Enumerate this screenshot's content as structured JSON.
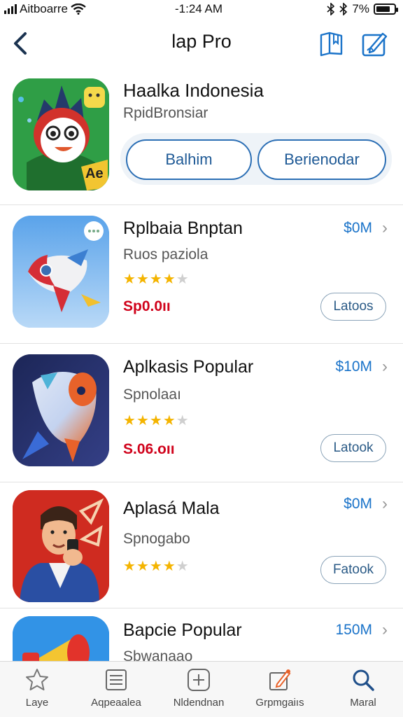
{
  "status_bar": {
    "carrier": "Aitboarre",
    "time": "-1:24 AM",
    "battery": "7%",
    "battery_level": 0.8
  },
  "header": {
    "title": "lap Pro",
    "back_icon": "chevron-left-icon",
    "actions": [
      "bookmark-book-icon",
      "edit-icon"
    ]
  },
  "featured": {
    "name": "Haalka Indonesia",
    "subtitle": "RpidBronsiar",
    "button_1": "Balhim",
    "button_2": "Berienodar"
  },
  "apps": [
    {
      "name": "Rplbaia Bnptan",
      "subtitle": "Ruos paziola",
      "rating": 4,
      "price": "Sp0.0ıı",
      "size": "$0M",
      "action": "Latoos"
    },
    {
      "name": "Aplkasis Popular",
      "subtitle": "Spnolaaı",
      "rating": 4,
      "price": "S.06.oıı",
      "size": "$10M",
      "action": "Latook"
    },
    {
      "name": "Aplasá Mala",
      "subtitle": "Spnogabo",
      "rating": 4,
      "size": "$0M",
      "action": "Fatook"
    },
    {
      "name": "Bapcie Popular",
      "subtitle": "Sbwanaao",
      "size": "150M"
    }
  ],
  "tabs": [
    {
      "label": "Laye",
      "icon": "star-icon"
    },
    {
      "label": "Aqpeaalea",
      "icon": "list-icon"
    },
    {
      "label": "Nldendnan",
      "icon": "plus-box-icon"
    },
    {
      "label": "Grpmgaiıs",
      "icon": "edit-icon"
    },
    {
      "label": "Maral",
      "icon": "search-icon"
    }
  ],
  "colors": {
    "accent": "#1a73c9",
    "button_border": "#2c6fb5",
    "star": "#f4b400",
    "price": "#d0021b"
  }
}
